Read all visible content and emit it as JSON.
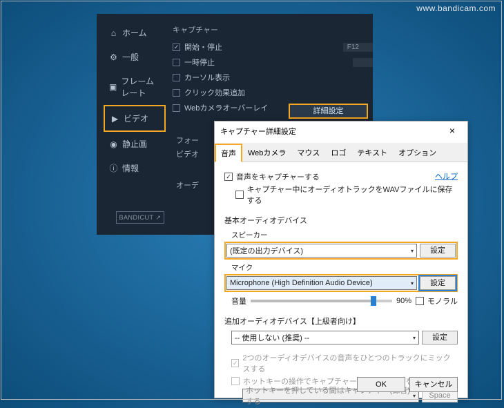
{
  "watermark": "www.bandicam.com",
  "sidebar": {
    "items": [
      {
        "label": "ホーム"
      },
      {
        "label": "一般"
      },
      {
        "label": "フレームレート"
      },
      {
        "label": "ビデオ"
      },
      {
        "label": "静止画"
      },
      {
        "label": "情報"
      }
    ]
  },
  "main": {
    "section_capture": "キャプチャー",
    "rows": [
      {
        "checked": true,
        "label": "開始・停止",
        "hotkey": "F12"
      },
      {
        "checked": false,
        "label": "一時停止",
        "hotkey": ""
      },
      {
        "checked": false,
        "label": "カーソル表示",
        "hotkey": null
      },
      {
        "checked": false,
        "label": "クリック効果追加",
        "hotkey": null
      },
      {
        "checked": false,
        "label": "Webカメラオーバーレイ",
        "hotkey": null
      }
    ],
    "detail_btn": "詳細設定",
    "format_label": "フォー",
    "video_label": "ビデオ",
    "audio_label": "オーデ"
  },
  "bandicut": "BANDICUT ↗",
  "dialog": {
    "title": "キャプチャー詳細設定",
    "tabs": [
      "音声",
      "Webカメラ",
      "マウス",
      "ロゴ",
      "テキスト",
      "オプション"
    ],
    "help": "ヘルプ",
    "capture_audio": "音声をキャプチャーする",
    "save_wav": "キャプチャー中にオーディオトラックをWAVファイルに保存する",
    "basic_device": "基本オーディオデバイス",
    "speaker_label": "スピーカー",
    "speaker_value": "(既定の出力デバイス)",
    "mic_label": "マイク",
    "mic_value": "Microphone (High Definition Audio Device)",
    "config_btn": "設定",
    "volume_label": "音量",
    "volume_percent": "90%",
    "mono": "モノラル",
    "additional_device": "追加オーディオデバイス【上級者向け】",
    "additional_value": "-- 使用しない (推奨) --",
    "mix_two": "2つのオーディオデバイスの音声をひとつのトラックにミックスする",
    "hotkey_toggle": "ホットキーの操作でキャプチャー(録音)ON/OFFを切り替える",
    "hotkey_hold": "ホットキーを押している間はキャプチャー(録音)する",
    "hotkey_value": "Space",
    "ok": "OK",
    "cancel": "キャンセル"
  }
}
